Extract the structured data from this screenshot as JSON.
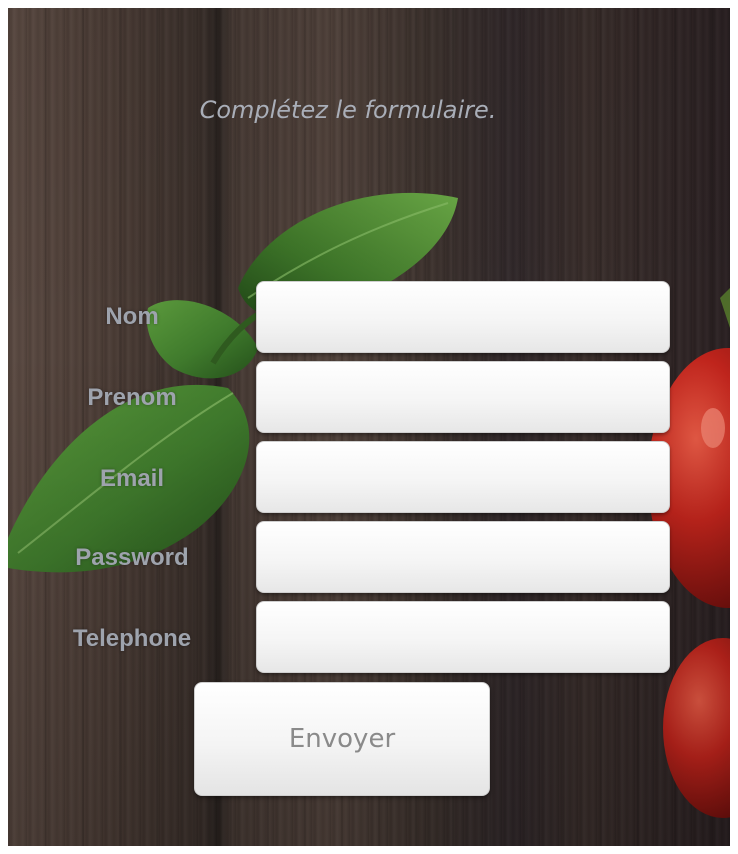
{
  "form": {
    "title": "Complétez le formulaire.",
    "fields": [
      {
        "label": "Nom",
        "value": "",
        "placeholder": ""
      },
      {
        "label": "Prenom",
        "value": "",
        "placeholder": ""
      },
      {
        "label": "Email",
        "value": "",
        "placeholder": ""
      },
      {
        "label": "Password",
        "value": "",
        "placeholder": ""
      },
      {
        "label": "Telephone",
        "value": "",
        "placeholder": ""
      }
    ],
    "submit_label": "Envoyer"
  },
  "background": {
    "description_icon": "wood-basil-tomato-photo",
    "colors": {
      "wood_dark": "#2a2320",
      "wood_light": "#5b4a42",
      "basil": "#3f7a2c",
      "tomato": "#c0241c",
      "label_text": "#9ea3ad",
      "title_text": "#a9aeb8"
    }
  }
}
